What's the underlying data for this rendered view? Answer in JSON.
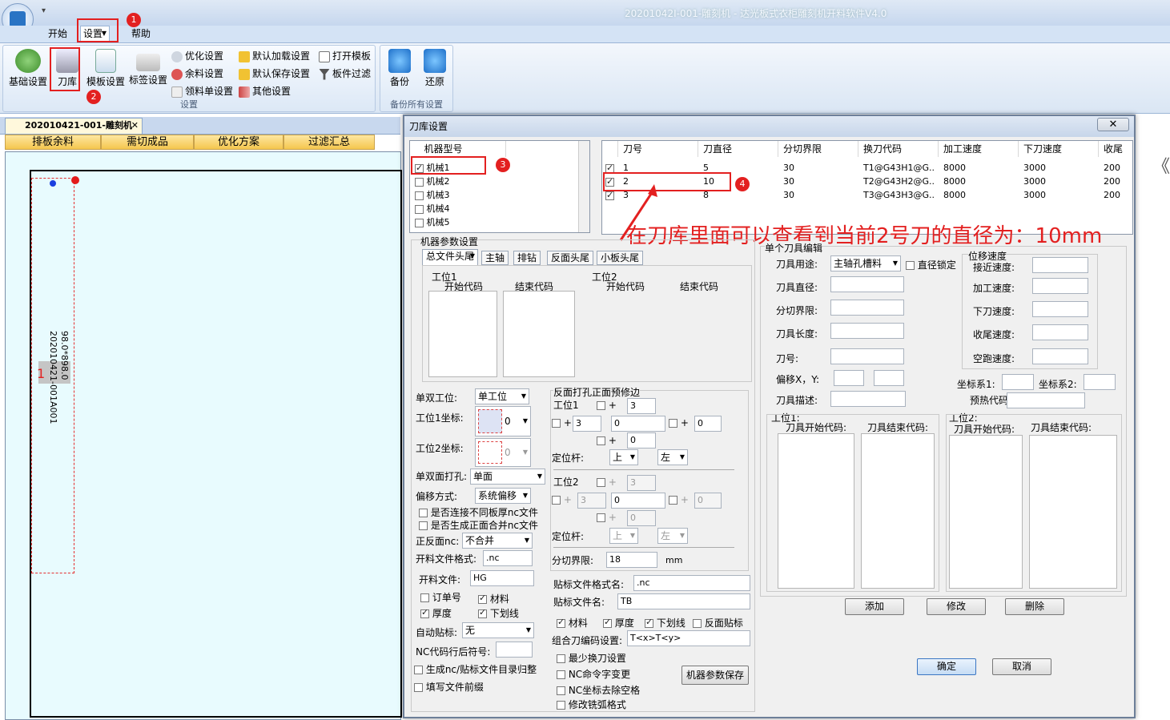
{
  "app": {
    "title": "20201042I-001-雕刻机 - 达光板式衣柜雕刻机开料软件V4.0"
  },
  "tabs": [
    "开始",
    "设置",
    "帮助"
  ],
  "ribbon": {
    "big_buttons": [
      "基础设置",
      "刀库",
      "模板设置",
      "标签设置"
    ],
    "small_col1": [
      "优化设置",
      "余料设置",
      "领料单设置"
    ],
    "small_col2": [
      "默认加载设置",
      "默认保存设置",
      "其他设置"
    ],
    "small_col3": [
      "打开模板",
      "板件过滤"
    ],
    "group1_label": "设置",
    "backup": [
      "备份",
      "还原"
    ],
    "group2_label": "备份所有设置"
  },
  "badges": [
    "1",
    "2",
    "3",
    "4"
  ],
  "doc_tab": "202010421-001-雕刻机",
  "sub_tabs": [
    "排板余料",
    "需切成品",
    "优化方案",
    "过滤汇总"
  ],
  "part": {
    "label": "202010421-001A001",
    "size": "98.0*898.0",
    "index": "1"
  },
  "dialog": {
    "title": "刀库设置",
    "machine_header": "机器型号",
    "machines": [
      {
        "name": "机械1",
        "checked": true
      },
      {
        "name": "机械2",
        "checked": false
      },
      {
        "name": "机械3",
        "checked": false
      },
      {
        "name": "机械4",
        "checked": false
      },
      {
        "name": "机械5",
        "checked": false
      }
    ],
    "tool_headers": [
      "刀号",
      "刀直径",
      "分切界限",
      "换刀代码",
      "加工速度",
      "下刀速度",
      "收尾"
    ],
    "tools": [
      [
        "1",
        "5",
        "30",
        "T1@G43H1@G...",
        "8000",
        "3000",
        "200"
      ],
      [
        "2",
        "10",
        "30",
        "T2@G43H2@G...",
        "8000",
        "3000",
        "200"
      ],
      [
        "3",
        "8",
        "30",
        "T3@G43H3@G...",
        "8000",
        "3000",
        "200"
      ]
    ],
    "annotation": "在刀库里面可以查看到当前2号刀的直径为：10mm",
    "params": {
      "legend": "机器参数设置",
      "tabs": [
        "总文件头尾",
        "主轴",
        "排钻",
        "反面头尾",
        "小板头尾"
      ],
      "st1": "工位1",
      "st2": "工位2",
      "start_code": "开始代码",
      "end_code": "结束代码",
      "single_double": "单双工位:",
      "single_double_val": "单工位",
      "st1_coord": "工位1坐标:",
      "st2_coord": "工位2坐标:",
      "coord_val": "0",
      "face": "单双面打孔:",
      "face_val": "单面",
      "offset": "偏移方式:",
      "offset_val": "系统偏移",
      "chk_connect": "是否连接不同板厚nc文件",
      "chk_merge": "是否生成正面合并nc文件",
      "front_back": "正反面nc:",
      "front_back_val": "不合并",
      "fmt": "开料文件格式:",
      "fmt_val": ".nc",
      "fname": "开料文件:",
      "fname_val": "HG",
      "order": "订单号",
      "material": "材料",
      "thickness": "厚度",
      "underline": "下划线",
      "auto_label": "自动贴标:",
      "auto_label_val": "无",
      "nc_suffix": "NC代码行后符号:",
      "chk_dir": "生成nc/贴标文件目录归整",
      "chk_prefix": "填写文件前缀"
    },
    "back": {
      "legend": "反面打孔正面预修边",
      "st1": "工位1",
      "st2": "工位2",
      "plus": "+",
      "v3": "3",
      "v0": "0",
      "pos": "定位杆:",
      "up": "上",
      "left": "左",
      "cut_limit": "分切界限:",
      "cut_val": "18",
      "mm": "mm",
      "label_fmt": "贴标文件格式名:",
      "label_fmt_val": ".nc",
      "label_name": "贴标文件名:",
      "label_name_val": "TB",
      "chk_mat": "材料",
      "chk_thk": "厚度",
      "chk_ul": "下划线",
      "chk_rev": "反面贴标",
      "combo": "组合刀编码设置:",
      "combo_val": "T<x>T<y>",
      "opt1": "最少换刀设置",
      "opt2": "NC命令字变更",
      "opt3": "NC坐标去除空格",
      "opt4": "修改铣弧格式",
      "save_btn": "机器参数保存"
    },
    "edit": {
      "legend": "单个刀具编辑",
      "usage": "刀具用途:",
      "usage_val": "主轴孔槽料",
      "diam_lock": "直径锁定",
      "diam": "刀具直径:",
      "limit": "分切界限:",
      "length": "刀具长度:",
      "num": "刀号:",
      "offset": "偏移X，Y:",
      "desc": "刀具描述:",
      "speed_legend": "位移速度",
      "approach": "接近速度:",
      "process": "加工速度:",
      "down": "下刀速度:",
      "finish": "收尾速度:",
      "idle": "空跑速度:",
      "coord1": "坐标系1:",
      "coord2": "坐标系2:",
      "preheat": "预热代码:",
      "st1": "工位1:",
      "st2": "工位2:",
      "tstart": "刀具开始代码:",
      "tend": "刀具结束代码:",
      "add": "添加",
      "modify": "修改",
      "delete": "删除"
    },
    "ok": "确定",
    "cancel": "取消"
  }
}
